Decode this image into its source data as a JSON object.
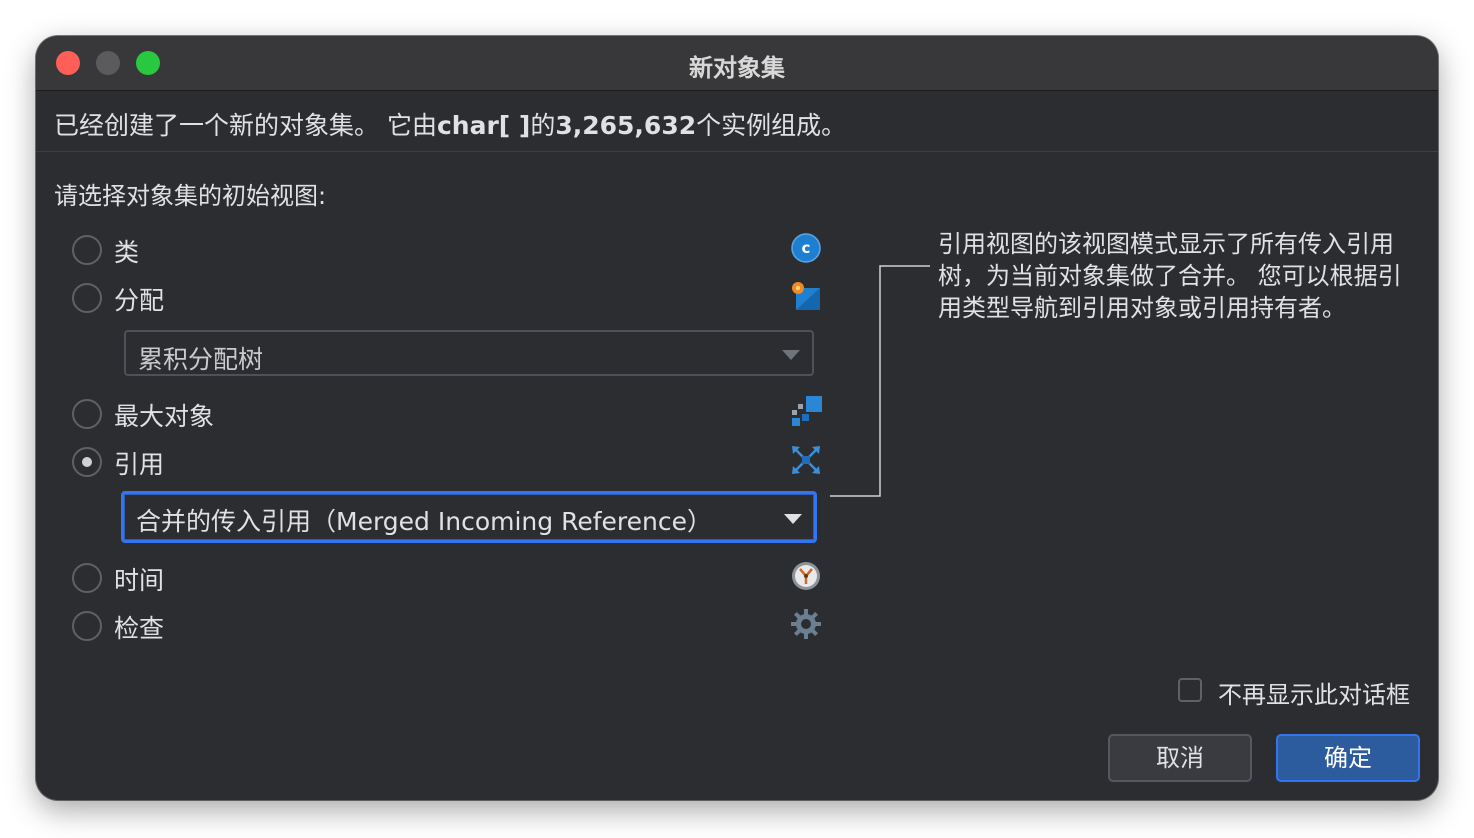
{
  "window": {
    "title": "新对象集"
  },
  "info": {
    "prefix": "已经创建了一个新的对象集。 它由",
    "type": "char[ ]",
    "middle": "的",
    "count": "3,265,632",
    "suffix": "个实例组成。"
  },
  "prompt": "请选择对象集的初始视图:",
  "options": [
    {
      "label": "类",
      "icon": "class-icon",
      "selected": false
    },
    {
      "label": "分配",
      "icon": "allocation-icon",
      "selected": false
    },
    {
      "label": "最大对象",
      "icon": "biggest-objects-icon",
      "selected": false
    },
    {
      "label": "引用",
      "icon": "references-icon",
      "selected": true
    },
    {
      "label": "时间",
      "icon": "time-icon",
      "selected": false
    },
    {
      "label": "检查",
      "icon": "inspection-gear-icon",
      "selected": false
    }
  ],
  "allocation_combo": {
    "value": "累积分配树"
  },
  "reference_combo": {
    "value": "合并的传入引用（Merged Incoming Reference）"
  },
  "description": "引用视图的该视图模式显示了所有传入引用树，为当前对象集做了合并。 您可以根据引用类型导航到引用对象或引用持有者。",
  "dont_show_again": {
    "label": "不再显示此对话框",
    "checked": false
  },
  "buttons": {
    "cancel": "取消",
    "ok": "确定"
  },
  "colors": {
    "background": "#2b2d30",
    "accent": "#3574f0",
    "primary_button": "#2c5b9e"
  }
}
